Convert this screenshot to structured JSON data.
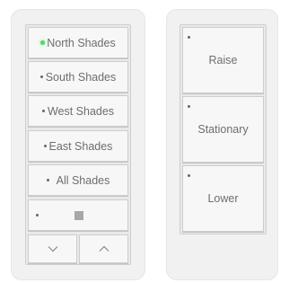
{
  "left_keypad": {
    "buttons": [
      {
        "label": "North Shades",
        "active": true
      },
      {
        "label": "South Shades",
        "active": false
      },
      {
        "label": "West Shades",
        "active": false
      },
      {
        "label": "East Shades",
        "active": false
      },
      {
        "label": "All Shades",
        "active": false
      }
    ],
    "stop_icon": "stop-square-icon",
    "lower_icon": "chevron-down-icon",
    "raise_icon": "chevron-up-icon"
  },
  "right_keypad": {
    "buttons": [
      {
        "label": "Raise"
      },
      {
        "label": "Stationary"
      },
      {
        "label": "Lower"
      }
    ]
  },
  "colors": {
    "active_led": "#4cd964",
    "inactive_led": "#666666",
    "text": "#6e6e6e",
    "faceplate": "#f1f1f1"
  }
}
